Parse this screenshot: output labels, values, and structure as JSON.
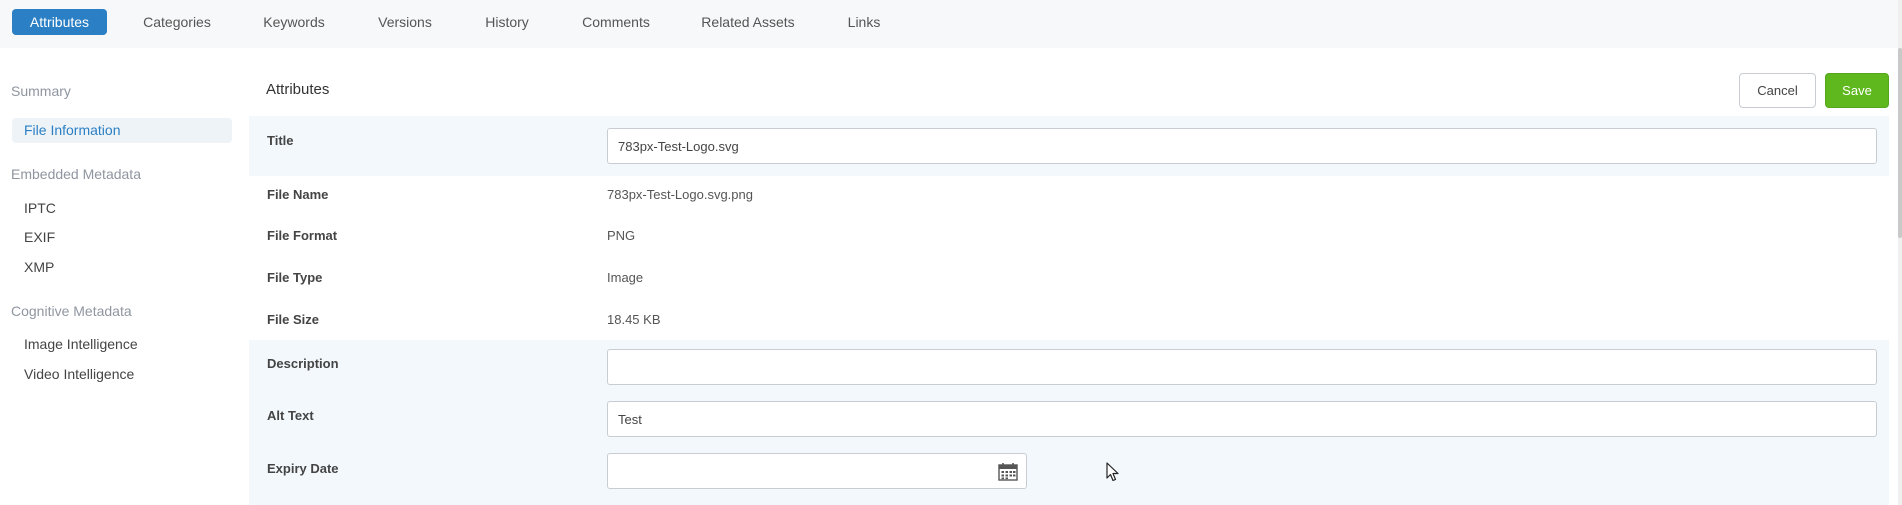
{
  "tabs": [
    {
      "label": "Attributes",
      "active": true
    },
    {
      "label": "Categories"
    },
    {
      "label": "Keywords"
    },
    {
      "label": "Versions"
    },
    {
      "label": "History"
    },
    {
      "label": "Comments"
    },
    {
      "label": "Related Assets"
    },
    {
      "label": "Links"
    }
  ],
  "sidebar": {
    "summary_heading": "Summary",
    "file_information": "File Information",
    "embedded_heading": "Embedded Metadata",
    "iptc": "IPTC",
    "exif": "EXIF",
    "xmp": "XMP",
    "cognitive_heading": "Cognitive Metadata",
    "image_intelligence": "Image Intelligence",
    "video_intelligence": "Video Intelligence"
  },
  "main": {
    "title": "Attributes",
    "cancel_label": "Cancel",
    "save_label": "Save",
    "fields": {
      "title": {
        "label": "Title",
        "value": "783px-Test-Logo.svg"
      },
      "file_name": {
        "label": "File Name",
        "value": "783px-Test-Logo.svg.png"
      },
      "file_format": {
        "label": "File Format",
        "value": "PNG"
      },
      "file_type": {
        "label": "File Type",
        "value": "Image"
      },
      "file_size": {
        "label": "File Size",
        "value": "18.45 KB"
      },
      "description": {
        "label": "Description",
        "value": ""
      },
      "alt_text": {
        "label": "Alt Text",
        "value": "Test"
      },
      "expiry_date": {
        "label": "Expiry Date",
        "value": ""
      }
    }
  },
  "colors": {
    "accent": "#2b7fc4",
    "save": "#5fb81e",
    "row_shade": "#f3f8fc"
  },
  "icons": {
    "calendar": "calendar-icon",
    "cursor": "mouse-pointer-icon"
  }
}
